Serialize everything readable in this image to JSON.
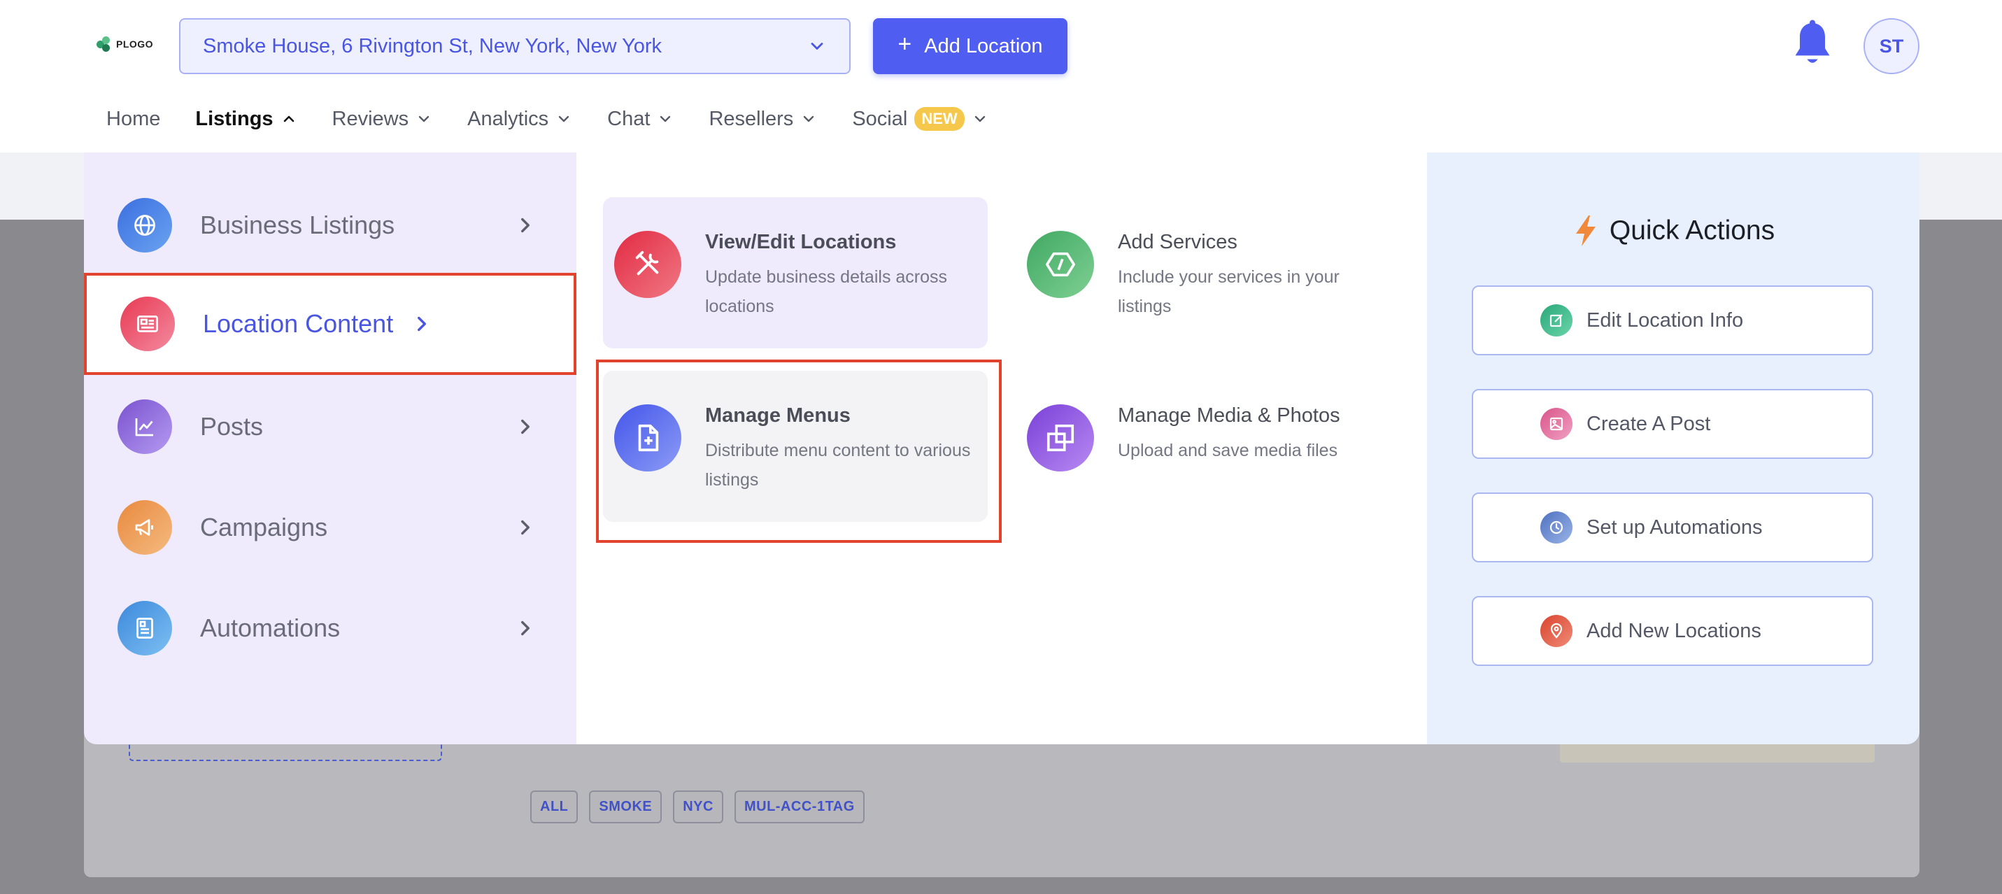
{
  "header": {
    "logo_text": "PLOGO",
    "location_select": {
      "value": "Smoke House, 6 Rivington St, New York, New York"
    },
    "add_location_label": "Add Location",
    "add_location_icon": "+",
    "avatar_initials": "ST"
  },
  "nav": {
    "items": [
      {
        "label": "Home"
      },
      {
        "label": "Listings"
      },
      {
        "label": "Reviews"
      },
      {
        "label": "Analytics"
      },
      {
        "label": "Chat"
      },
      {
        "label": "Resellers"
      },
      {
        "label": "Social",
        "badge": "NEW"
      }
    ]
  },
  "menu": {
    "left": [
      {
        "label": "Business Listings",
        "icon": "globe-icon",
        "color": "#4f7be8"
      },
      {
        "label": "Location Content",
        "icon": "newspaper-icon",
        "color": "#ea4d5c"
      },
      {
        "label": "Posts",
        "icon": "chart-icon",
        "color": "#8a62d6"
      },
      {
        "label": "Campaigns",
        "icon": "megaphone-icon",
        "color": "#eb9a52"
      },
      {
        "label": "Automations",
        "icon": "document-icon",
        "color": "#4c9ae2"
      }
    ],
    "middle": [
      {
        "title": "View/Edit Locations",
        "desc": "Update business details across locations",
        "icon": "tools-icon",
        "color": "#e5384d"
      },
      {
        "title": "Add Services",
        "desc": "Include your services in your listings",
        "icon": "hexagon-icon",
        "color": "#4eaf6a"
      },
      {
        "title": "Manage Menus",
        "desc": "Distribute menu content to various listings",
        "icon": "file-plus-icon",
        "color": "#5a6cf0"
      },
      {
        "title": "Manage Media & Photos",
        "desc": "Upload and save media files",
        "icon": "copy-icon",
        "color": "#8a56e0"
      }
    ]
  },
  "quick_actions": {
    "title": "Quick Actions",
    "items": [
      {
        "label": "Edit Location Info",
        "icon": "edit-icon",
        "color": "#3db38a"
      },
      {
        "label": "Create A Post",
        "icon": "image-icon",
        "color": "#e272a0"
      },
      {
        "label": "Set up Automations",
        "icon": "clock-icon",
        "color": "#6d8fd0"
      },
      {
        "label": "Add New Locations",
        "icon": "pin-icon",
        "color": "#e2604a"
      }
    ]
  },
  "background": {
    "tags": [
      "ALL",
      "SMOKE",
      "NYC",
      "MUL-ACC-1TAG"
    ]
  }
}
